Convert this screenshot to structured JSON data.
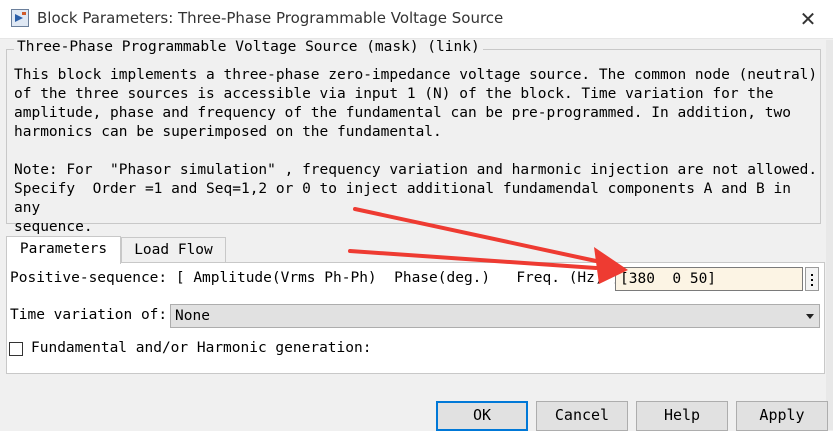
{
  "window": {
    "title": "Block Parameters: Three-Phase Programmable Voltage Source",
    "close_glyph": "✕",
    "icon": "simulink-block-icon"
  },
  "mask": {
    "title": "Three-Phase Programmable Voltage Source (mask) (link)",
    "description": "This block implements a three-phase zero-impedance voltage source. The common node (neutral)\nof the three sources is accessible via input 1 (N) of the block. Time variation for the\namplitude, phase and frequency of the fundamental can be pre-programmed. In addition, two\nharmonics can be superimposed on the fundamental.\n\nNote: For  \"Phasor simulation\" , frequency variation and harmonic injection are not allowed.\nSpecify  Order =1 and Seq=1,2 or 0 to inject additional fundamendal components A and B in  any\nsequence."
  },
  "tabs": [
    {
      "label": "Parameters",
      "active": true
    },
    {
      "label": "Load Flow",
      "active": false
    }
  ],
  "parameters": {
    "positive_sequence_label": "Positive-sequence: [ Amplitude(Vrms Ph-Ph)  Phase(deg.)   Freq. (Hz) ]",
    "positive_sequence_value": "[380  0 50]",
    "time_variation_label": "Time variation of:",
    "time_variation_value": "None",
    "harmonic_label": "Fundamental and/or Harmonic generation:",
    "harmonic_checked": false
  },
  "buttons": {
    "ok": "OK",
    "cancel": "Cancel",
    "help": "Help",
    "apply": "Apply"
  },
  "annotation": {
    "arrow_color": "#ee3b32"
  },
  "colors": {
    "field_background": "#fcf4e4",
    "default_button_border": "#0078d7"
  }
}
